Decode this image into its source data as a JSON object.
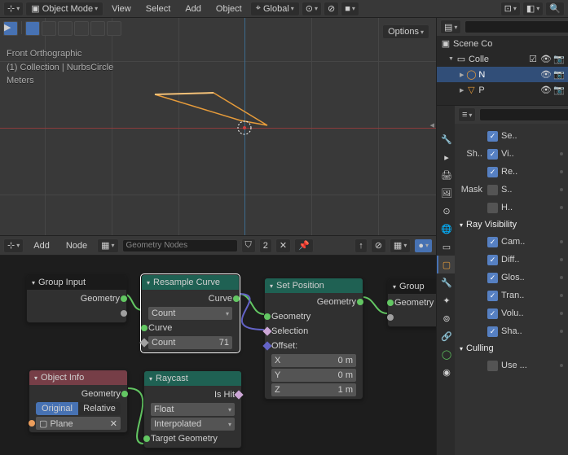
{
  "header": {
    "mode": "Object Mode",
    "view": "View",
    "select": "Select",
    "add": "Add",
    "object": "Object",
    "orientation": "Global",
    "options": "Options"
  },
  "viewport": {
    "line1": "Front Orthographic",
    "line2": "(1) Collection | NurbsCircle",
    "line3": "Meters"
  },
  "node_header": {
    "add": "Add",
    "node": "Node",
    "tree_name": "Geometry Nodes"
  },
  "nodes": {
    "group_input": {
      "title": "Group Input",
      "out_geometry": "Geometry"
    },
    "resample": {
      "title": "Resample Curve",
      "out_curve": "Curve",
      "mode": "Count",
      "in_curve": "Curve",
      "count_label": "Count",
      "count_value": "71"
    },
    "object_info": {
      "title": "Object Info",
      "out_geometry": "Geometry",
      "seg_original": "Original",
      "seg_relative": "Relative",
      "object": "Plane"
    },
    "raycast": {
      "title": "Raycast",
      "out_ishit": "Is Hit",
      "type1": "Float",
      "type2": "Interpolated",
      "in_target": "Target Geometry"
    },
    "set_position": {
      "title": "Set Position",
      "out_geometry": "Geometry",
      "in_geometry": "Geometry",
      "in_selection": "Selection",
      "offset": "Offset:",
      "x": "X",
      "xv": "0 m",
      "y": "Y",
      "yv": "0 m",
      "z": "Z",
      "zv": "1 m"
    },
    "group_output": {
      "title": "Group",
      "in_geometry": "Geometry"
    }
  },
  "outliner": {
    "scene": "Scene Co",
    "collection": "Colle",
    "obj_n": "N",
    "obj_p": "P"
  },
  "properties": {
    "search_placeholder": "",
    "se": "Se..",
    "sh": "Sh..",
    "vi": "Vi..",
    "mask": "Mask",
    "re": "Re..",
    "s": "S..",
    "h": "H..",
    "ray_visibility": "Ray Visibility",
    "cam": "Cam..",
    "diff": "Diff..",
    "glos": "Glos..",
    "tran": "Tran..",
    "volu": "Volu..",
    "sha": "Sha..",
    "culling": "Culling",
    "use": "Use ..."
  }
}
